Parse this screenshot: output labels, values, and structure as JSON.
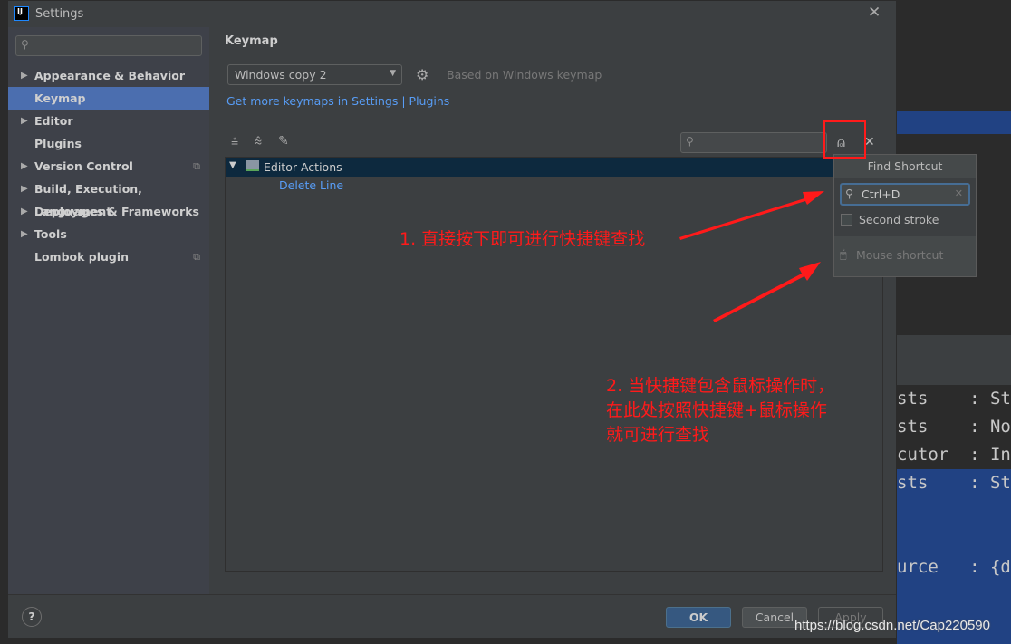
{
  "window": {
    "title": "Settings",
    "close_icon": "close-icon"
  },
  "sidebar": {
    "search_placeholder": "",
    "items": [
      {
        "label": "Appearance & Behavior",
        "expandable": true
      },
      {
        "label": "Keymap",
        "selected": true
      },
      {
        "label": "Editor",
        "expandable": true
      },
      {
        "label": "Plugins"
      },
      {
        "label": "Version Control",
        "expandable": true,
        "project_icon": true
      },
      {
        "label": "Build, Execution, Deployment",
        "expandable": true
      },
      {
        "label": "Languages & Frameworks",
        "expandable": true
      },
      {
        "label": "Tools",
        "expandable": true
      },
      {
        "label": "Lombok plugin",
        "project_icon": true
      }
    ]
  },
  "main": {
    "title": "Keymap",
    "keymap_select": "Windows copy 2",
    "based_on": "Based on Windows keymap",
    "link_text": "Get more keymaps in Settings | Plugins",
    "tree": [
      {
        "label": "Editor Actions",
        "children": [
          "Delete Line"
        ]
      }
    ]
  },
  "find_shortcut": {
    "title": "Find Shortcut",
    "value": "Ctrl+D",
    "second_stroke": "Second stroke",
    "second_stroke_checked": false,
    "mouse_shortcut": "Mouse shortcut"
  },
  "footer": {
    "ok": "OK",
    "cancel": "Cancel",
    "apply": "Apply",
    "help": "?"
  },
  "annotations": {
    "note1": "1. 直接按下即可进行快捷键查找",
    "note2_line1": "2. 当快捷键包含鼠标操作时，",
    "note2_line2": "在此处按照快捷键+鼠标操作",
    "note2_line3": "就可进行查找",
    "color": "#ff1a1a"
  },
  "background_console": [
    {
      "left": "sts",
      "right": ": Sta"
    },
    {
      "left": "sts",
      "right": ": No"
    },
    {
      "left": "cutor",
      "right": ": Ini"
    },
    {
      "left": "sts",
      "right": ": Sta"
    },
    {
      "left": "urce",
      "right": ": {da"
    }
  ],
  "watermark": "https://blog.csdn.net/Cap220590"
}
